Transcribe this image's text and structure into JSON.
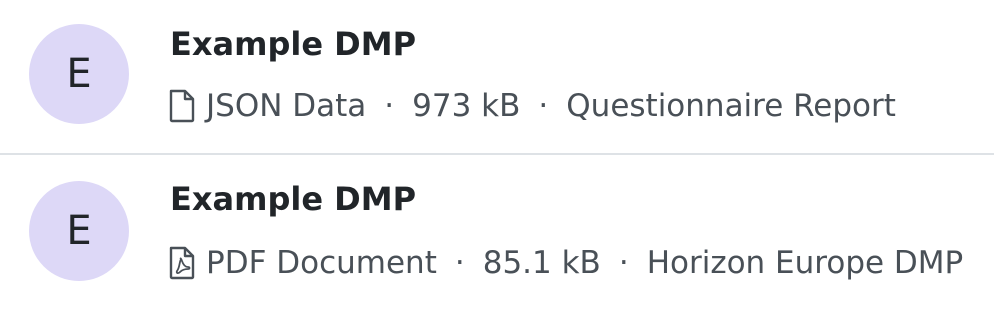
{
  "documents": [
    {
      "avatar_letter": "E",
      "avatar_color": "#ddd8f7",
      "title": "Example DMP",
      "file_type": "JSON Data",
      "file_icon": "file-icon",
      "size": "973 kB",
      "template": "Questionnaire Report"
    },
    {
      "avatar_letter": "E",
      "avatar_color": "#ddd8f7",
      "title": "Example DMP",
      "file_type": "PDF Document",
      "file_icon": "file-pdf-icon",
      "size": "85.1 kB",
      "template": "Horizon Europe DMP"
    }
  ],
  "separator": "·",
  "colors": {
    "divider": "#dee2e6",
    "text": "#212529",
    "muted_text": "#495057"
  }
}
